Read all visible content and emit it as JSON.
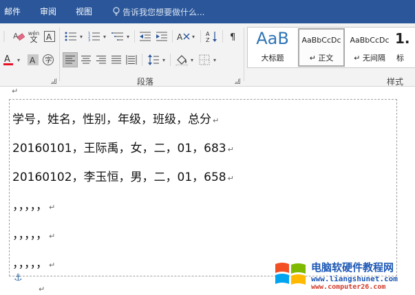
{
  "tabs": [
    {
      "label": "邮件"
    },
    {
      "label": "审阅"
    },
    {
      "label": "视图"
    }
  ],
  "tell_me": {
    "placeholder": "告诉我您想要做什么..."
  },
  "ribbon": {
    "font_group": {
      "phonetic_guide_text": "wén",
      "phonetic_guide_char": "文"
    },
    "paragraph_group": {
      "label": "段落"
    },
    "styles_group": {
      "label": "样式",
      "styles": [
        {
          "preview": "AaB",
          "name": "大标题"
        },
        {
          "preview": "AaBbCcDc",
          "name": "↵ 正文"
        },
        {
          "preview": "AaBbCcDc",
          "name": "↵ 无间隔"
        },
        {
          "preview": "1.",
          "name": "标"
        }
      ]
    }
  },
  "document": {
    "lines": [
      {
        "text": "学号，姓名，性别，年级，班级，总分"
      },
      {
        "text": "20160101，王际禹，女，二，01，683"
      },
      {
        "text": "20160102，李玉恒，男，二，01，658"
      },
      {
        "text": "，，，，，"
      },
      {
        "text": "，，，，，"
      },
      {
        "text": "，，，，，"
      }
    ],
    "paragraph_mark": "↵"
  },
  "watermark": {
    "title": "电脑软硬件教程网",
    "url1": "www.liangshunet.com",
    "url2": "www.computer26.com"
  },
  "colors": {
    "tab_bar": "#2b579a",
    "ribbon": "#f3f3f3",
    "font_color_red": "#e81123",
    "watermark_blue": "#1d57b5",
    "watermark_red": "#d23a2b"
  }
}
